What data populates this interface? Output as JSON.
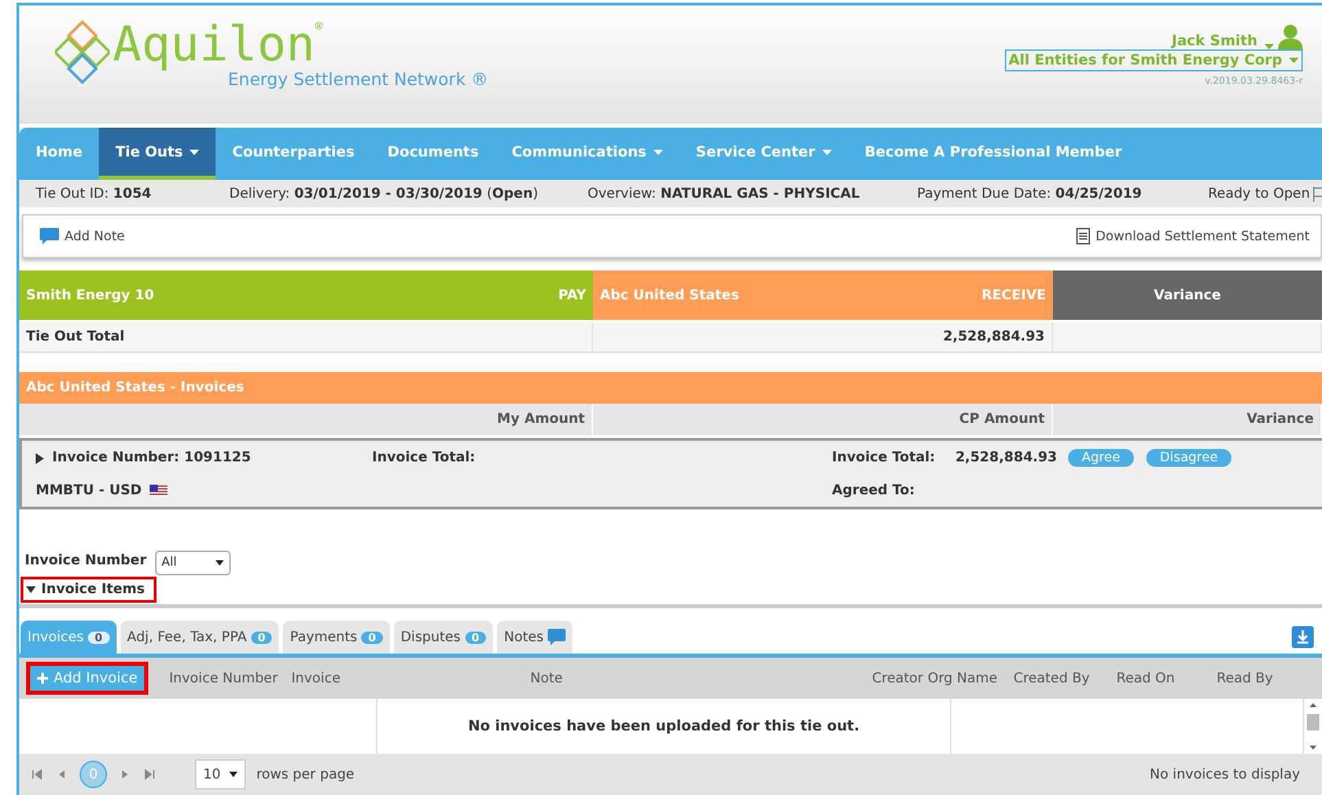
{
  "header": {
    "logo": "Aquilon",
    "registered": "®",
    "tagline": "Energy Settlement Network ®",
    "user": "Jack Smith",
    "entity": "All Entities for Smith Energy Corp",
    "version": "v.2019.03.29.8463-r"
  },
  "nav": [
    {
      "label": "Home",
      "selected": false,
      "dropdown": false
    },
    {
      "label": "Tie Outs",
      "selected": true,
      "dropdown": true
    },
    {
      "label": "Counterparties",
      "selected": false,
      "dropdown": false
    },
    {
      "label": "Documents",
      "selected": false,
      "dropdown": false
    },
    {
      "label": "Communications",
      "selected": false,
      "dropdown": true
    },
    {
      "label": "Service Center",
      "selected": false,
      "dropdown": true
    },
    {
      "label": "Become A Professional Member",
      "selected": false,
      "dropdown": false
    }
  ],
  "info_bar": [
    "Tie Out ID: **1054**",
    "Delivery: **03/01/2019 - 03/30/2019** (**Open**)",
    "Overview: **NATURAL GAS - PHYSICAL**",
    "Payment Due Date: **04/25/2019**",
    "Ready to Open"
  ],
  "toolbar": {
    "add_note": "Add Note",
    "download": "Download Settlement Statement"
  },
  "tie_out": {
    "columns": [
      {
        "kind": "pay",
        "name": "Smith Energy 10",
        "role": "PAY"
      },
      {
        "kind": "receive",
        "name": "Abc United States",
        "role": "RECEIVE"
      },
      {
        "kind": "variance",
        "name": "Variance"
      }
    ],
    "row_label": "Tie Out Total",
    "receive_total": "2,528,884.93"
  },
  "invoices": {
    "title": "Abc United States - Invoices",
    "columns": [
      "My Amount",
      "CP Amount",
      "Variance"
    ],
    "invoice": {
      "expanded": false,
      "number": "Invoice Number: 1091125",
      "my_total_label": "Invoice Total:",
      "cp_total_label": "Invoice Total:",
      "cp_total": "2,528,884.93",
      "unit": "MMBTU - USD",
      "agreed_label": "Agreed To:",
      "actions": [
        "Agree",
        "Disagree"
      ]
    }
  },
  "filter": {
    "label": "Invoice Number",
    "value": "All"
  },
  "items": {
    "title": "Invoice Items",
    "expanded": true,
    "highlighted": true
  },
  "tabs": [
    {
      "kind": "count",
      "label": "Invoices",
      "count": "0",
      "selected": true
    },
    {
      "kind": "count",
      "label": "Adj, Fee, Tax, PPA",
      "count": "0",
      "selected": false
    },
    {
      "kind": "count",
      "label": "Payments",
      "count": "0",
      "selected": false
    },
    {
      "kind": "count",
      "label": "Disputes",
      "count": "0",
      "selected": false
    },
    {
      "kind": "icon",
      "label": "Notes",
      "selected": false
    }
  ],
  "grid": {
    "add_button": {
      "label": "Add Invoice",
      "highlighted": true
    },
    "columns": [
      "Invoice Number",
      "Invoice",
      "Note",
      "Creator Org Name",
      "Created By",
      "Read On",
      "Read By"
    ],
    "empty": "No invoices have been uploaded for this tie out."
  },
  "pager": {
    "page": "0",
    "page_size": "10",
    "page_size_label": "rows per page",
    "status": "No invoices to display"
  }
}
